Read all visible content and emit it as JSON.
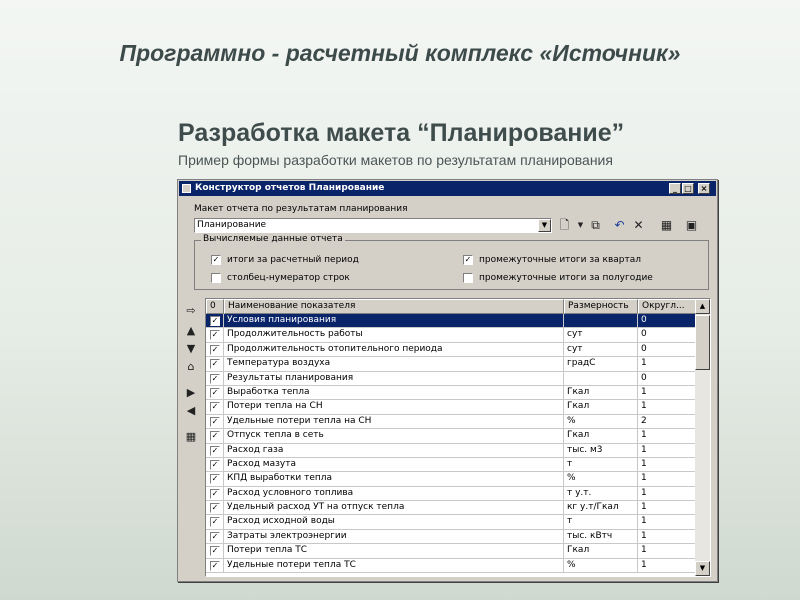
{
  "slide": {
    "title": "Программно - расчетный комплекс «Источник»",
    "subtitle": "Разработка макета “Планирование”",
    "caption": "Пример формы разработки макетов по результатам планирования"
  },
  "window": {
    "title": "Конструктор отчетов Планирование",
    "controls": {
      "minimize": "_",
      "maximize": "□",
      "close": "×"
    },
    "layout_label": "Макет отчета по результатам планирования",
    "layout_value": "Планирование",
    "toolbar_icons": [
      "new-doc-icon",
      "dropdown-icon",
      "copy-icon",
      "undo-icon",
      "delete-icon",
      "grid-icon",
      "save-icon"
    ],
    "group_label": "Вычисляемые данные отчета",
    "options": [
      {
        "label": "итоги за расчетный период",
        "checked": true
      },
      {
        "label": "столбец-нумератор строк",
        "checked": false
      },
      {
        "label": "промежуточные итоги за квартал",
        "checked": true
      },
      {
        "label": "промежуточные итоги за полугодие",
        "checked": false
      }
    ],
    "side_icons": [
      "move-right-icon",
      "arrow-up-icon",
      "arrow-down-icon",
      "home-icon",
      "arrow-right-icon",
      "arrow-left-icon",
      "grid-settings-icon"
    ]
  },
  "table": {
    "headers": [
      "0",
      "Наименование показателя",
      "Размерность",
      "Округл..."
    ],
    "rows": [
      {
        "checked": true,
        "name": "Условия планирования",
        "unit": "",
        "round": "0",
        "selected": true
      },
      {
        "checked": true,
        "name": "Продолжительность работы",
        "unit": "сут",
        "round": "0"
      },
      {
        "checked": true,
        "name": "Продолжительность отопительного периода",
        "unit": "сут",
        "round": "0"
      },
      {
        "checked": true,
        "name": "Температура воздуха",
        "unit": "градС",
        "round": "1"
      },
      {
        "checked": true,
        "name": "Результаты планирования",
        "unit": "",
        "round": "0"
      },
      {
        "checked": true,
        "name": "Выработка тепла",
        "unit": "Гкал",
        "round": "1"
      },
      {
        "checked": true,
        "name": "Потери тепла на СН",
        "unit": "Гкал",
        "round": "1"
      },
      {
        "checked": true,
        "name": "Удельные потери тепла на СН",
        "unit": "%",
        "round": "2"
      },
      {
        "checked": true,
        "name": "Отпуск тепла в сеть",
        "unit": "Гкал",
        "round": "1"
      },
      {
        "checked": true,
        "name": "Расход газа",
        "unit": "тыс. м3",
        "round": "1"
      },
      {
        "checked": true,
        "name": "Расход мазута",
        "unit": "т",
        "round": "1"
      },
      {
        "checked": true,
        "name": "КПД выработки тепла",
        "unit": "%",
        "round": "1"
      },
      {
        "checked": true,
        "name": "Расход условного топлива",
        "unit": "т у.т.",
        "round": "1"
      },
      {
        "checked": true,
        "name": "Удельный расход УТ на отпуск тепла",
        "unit": "кг у.т/Гкал",
        "round": "1"
      },
      {
        "checked": true,
        "name": "Расход исходной воды",
        "unit": "т",
        "round": "1"
      },
      {
        "checked": true,
        "name": "Затраты электроэнергии",
        "unit": "тыс. кВтч",
        "round": "1"
      },
      {
        "checked": true,
        "name": "Потери тепла ТС",
        "unit": "Гкал",
        "round": "1"
      },
      {
        "checked": true,
        "name": "Удельные потери тепла ТС",
        "unit": "%",
        "round": "1"
      }
    ]
  },
  "colors": {
    "selection": "#0a246a",
    "window_bg": "#d4d0c8",
    "title_text": "#3c4a4a"
  }
}
